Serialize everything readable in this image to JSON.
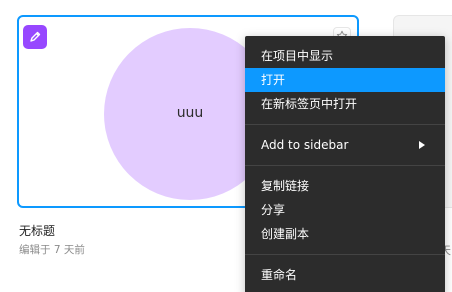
{
  "file_card": {
    "thumbnail_label": "uuu",
    "badge_color": "#9747ff",
    "circle_color": "#e3ccff",
    "selected_border_color": "#0d99ff"
  },
  "file": {
    "title": "无标题",
    "subtitle": "编辑于 7 天前"
  },
  "neighbor_card": {
    "subtitle_fragment": "天"
  },
  "context_menu": {
    "groups": [
      [
        "在项目中显示",
        "打开",
        "在新标签页中打开"
      ],
      [
        "Add to sidebar"
      ],
      [
        "复制链接",
        "分享",
        "创建副本"
      ],
      [
        "重命名"
      ]
    ],
    "active_item": "打开",
    "submenu_item": "Add to sidebar",
    "background": "#2c2c2c",
    "highlight": "#0d99ff"
  }
}
